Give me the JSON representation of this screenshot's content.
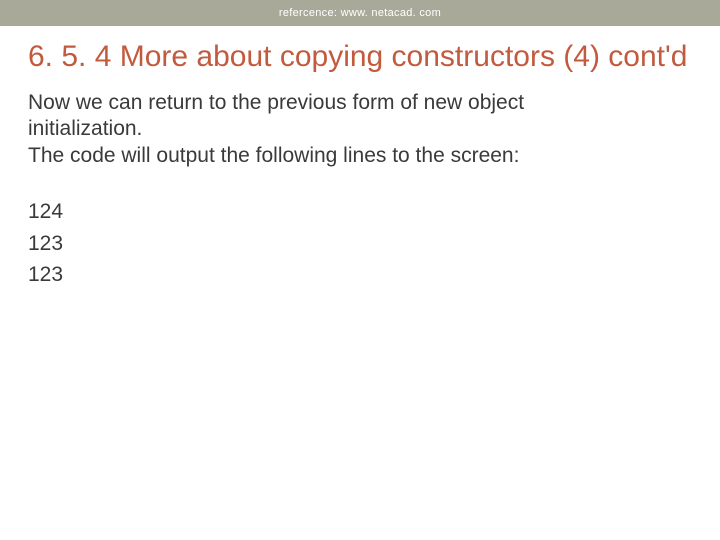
{
  "header": {
    "reference_text": "refercence: www. netacad. com"
  },
  "title": "6. 5. 4 More about copying constructors (4) cont'd",
  "body": {
    "line1": "Now we can return to the previous form of new object initialization.",
    "line2": "The code will output the following lines to the screen:"
  },
  "output": [
    "124",
    "123",
    "123"
  ]
}
